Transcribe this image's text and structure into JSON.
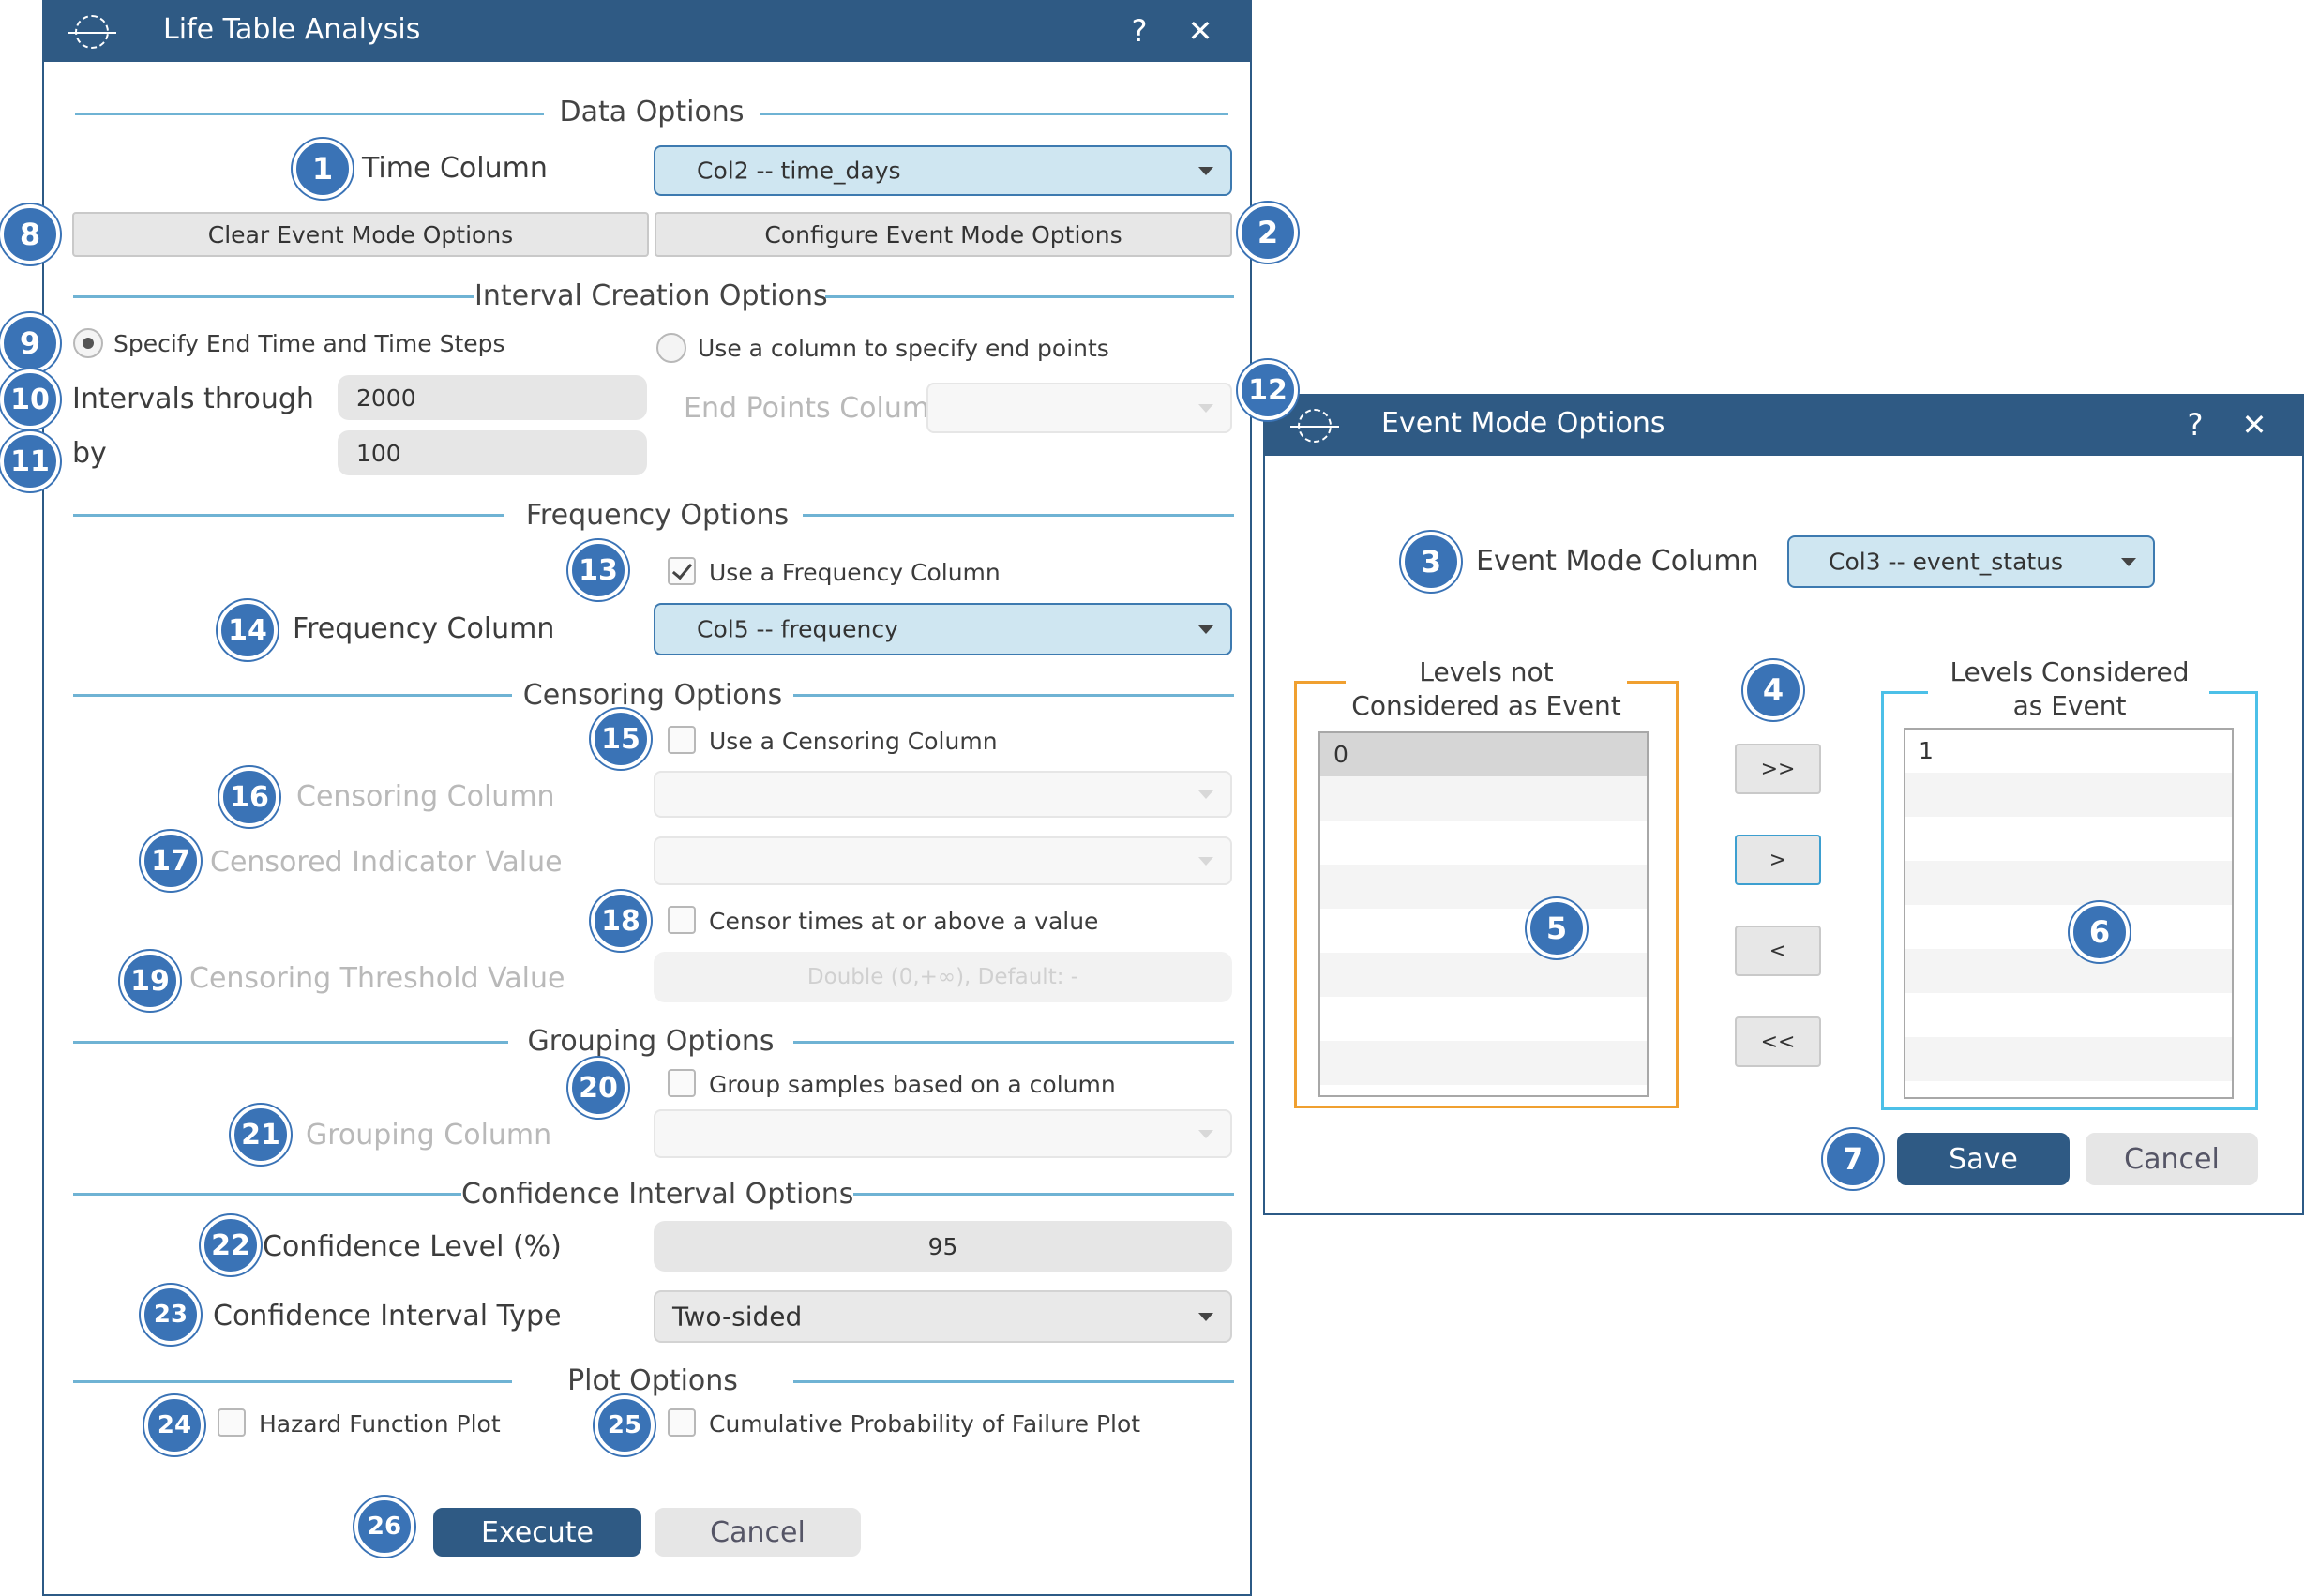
{
  "life_table": {
    "title": "Life Table Analysis",
    "help": "?",
    "close": "✕",
    "data_options": "Data Options",
    "time_column_label": "Time Column",
    "time_column_value": "Col2 -- time_days",
    "clear_event_btn": "Clear Event Mode Options",
    "configure_event_btn": "Configure Event Mode Options",
    "interval_options": "Interval Creation Options",
    "radio_end_time": "Specify End Time and Time Steps",
    "radio_column_end": "Use a column to specify end points",
    "intervals_through_label": "Intervals through",
    "intervals_through_value": "2000",
    "by_label": "by",
    "by_value": "100",
    "end_points_label": "End Points Column",
    "frequency_options": "Frequency Options",
    "use_frequency": "Use a Frequency Column",
    "frequency_column_label": "Frequency Column",
    "frequency_column_value": "Col5 -- frequency",
    "censoring_options": "Censoring Options",
    "use_censoring": "Use a Censoring Column",
    "censoring_column_label": "Censoring Column",
    "censored_indicator_label": "Censored Indicator Value",
    "censor_times": "Censor times at or above a value",
    "censoring_threshold_label": "Censoring Threshold Value",
    "censoring_threshold_placeholder": "Double (0,+∞), Default: -",
    "grouping_options": "Grouping Options",
    "group_samples": "Group samples based on a column",
    "grouping_column_label": "Grouping Column",
    "ci_options": "Confidence Interval Options",
    "confidence_level_label": "Confidence Level (%)",
    "confidence_level_value": "95",
    "ci_type_label": "Confidence Interval Type",
    "ci_type_value": "Two-sided",
    "plot_options": "Plot Options",
    "hazard_plot": "Hazard Function Plot",
    "cum_prob_plot": "Cumulative Probability of Failure Plot",
    "execute": "Execute",
    "cancel": "Cancel"
  },
  "event_mode": {
    "title": "Event Mode Options",
    "help": "?",
    "close": "✕",
    "event_column_label": "Event Mode Column",
    "event_column_value": "Col3 -- event_status",
    "levels_not_title_1": "Levels not",
    "levels_not_title_2": "Considered as Event",
    "levels_yes_title_1": "Levels Considered",
    "levels_yes_title_2": "as Event",
    "levels_not": [
      "0"
    ],
    "levels_yes": [
      "1"
    ],
    "btn_all_right": ">>",
    "btn_right": ">",
    "btn_left": "<",
    "btn_all_left": "<<",
    "save": "Save",
    "cancel": "Cancel"
  },
  "badges": [
    "1",
    "2",
    "3",
    "4",
    "5",
    "6",
    "7",
    "8",
    "9",
    "10",
    "11",
    "12",
    "13",
    "14",
    "15",
    "16",
    "17",
    "18",
    "19",
    "20",
    "21",
    "22",
    "23",
    "24",
    "25",
    "26"
  ],
  "colors": {
    "title_bar": "#2f5a84",
    "badge": "#3a73b6",
    "section_line": "#6fb3d4",
    "combo_fill": "#cfe6f1",
    "orange_frame": "#f0a030",
    "cyan_frame": "#4cc0e8"
  }
}
